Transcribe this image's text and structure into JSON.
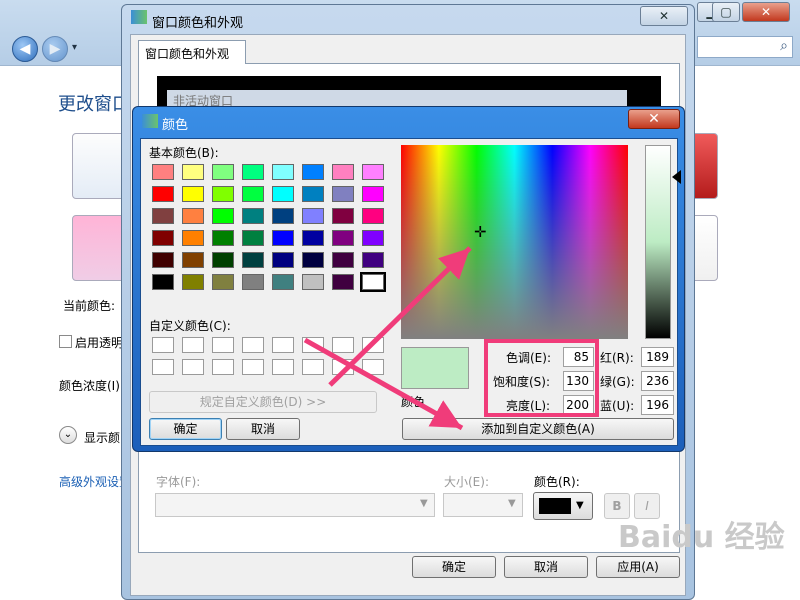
{
  "explorer": {
    "title": "更改窗口",
    "current_color_label": "当前颜色:",
    "enable_transparency_label": "启用透明",
    "color_intensity_label": "颜色浓度(I):",
    "show_mixer_label": "显示颜",
    "advanced_link": "高级外观设置"
  },
  "appearance_dialog": {
    "title": "窗口颜色和外观",
    "tab_label": "窗口颜色和外观",
    "preview_inactive_window": "非活动窗口",
    "font_label": "字体(F):",
    "size_label": "大小(E):",
    "color_label": "颜色(R):",
    "bold_label": "B",
    "italic_label": "I",
    "ok_label": "确定",
    "cancel_label": "取消",
    "apply_label": "应用(A)"
  },
  "color_dialog": {
    "title": "颜色",
    "close_label": "✕",
    "basic_colors_label": "基本颜色(B):",
    "custom_colors_label": "自定义颜色(C):",
    "define_custom_label": "规定自定义颜色(D) >>",
    "ok_label": "确定",
    "cancel_label": "取消",
    "add_custom_label": "添加到自定义颜色(A)",
    "color_solid_label": "颜色",
    "hue_label": "色调(E):",
    "hue_value": "85",
    "sat_label": "饱和度(S):",
    "sat_value": "130",
    "lum_label": "亮度(L):",
    "lum_value": "200",
    "red_label": "红(R):",
    "red_value": "189",
    "green_label": "绿(G):",
    "green_value": "236",
    "blue_label": "蓝(U):",
    "blue_value": "196",
    "selected_color": "#bdecc4",
    "basic_colors": [
      [
        "#ff8080",
        "#ffff80",
        "#80ff80",
        "#00ff80",
        "#80ffff",
        "#0080ff",
        "#ff80c0",
        "#ff80ff"
      ],
      [
        "#ff0000",
        "#ffff00",
        "#80ff00",
        "#00ff40",
        "#00ffff",
        "#0080c0",
        "#8080c0",
        "#ff00ff"
      ],
      [
        "#804040",
        "#ff8040",
        "#00ff00",
        "#008080",
        "#004080",
        "#8080ff",
        "#800040",
        "#ff0080"
      ],
      [
        "#800000",
        "#ff8000",
        "#008000",
        "#008040",
        "#0000ff",
        "#0000a0",
        "#800080",
        "#8000ff"
      ],
      [
        "#400000",
        "#804000",
        "#004000",
        "#004040",
        "#000080",
        "#000040",
        "#400040",
        "#400080"
      ],
      [
        "#000000",
        "#808000",
        "#808040",
        "#808080",
        "#408080",
        "#c0c0c0",
        "#400040",
        "#ffffff"
      ]
    ]
  },
  "watermark": "Baidu 经验"
}
